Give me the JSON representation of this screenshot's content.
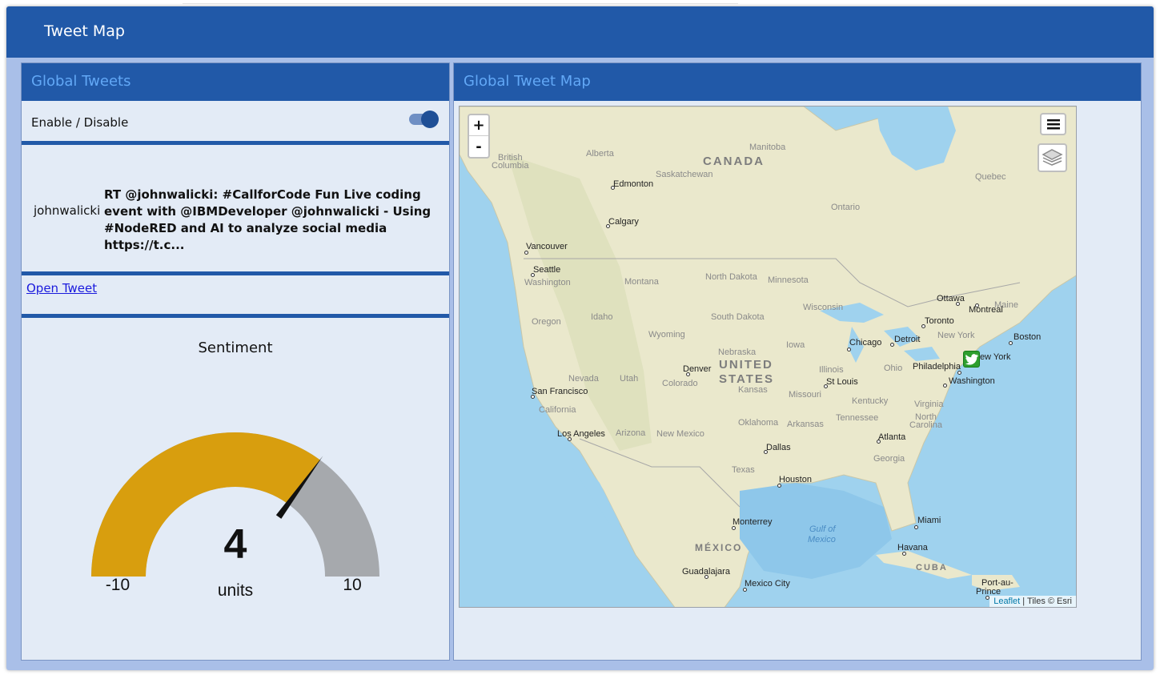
{
  "app": {
    "title": "Tweet Map"
  },
  "left_group": {
    "title": "Global Tweets",
    "toggle_label": "Enable / Disable",
    "toggle_on": true,
    "tweet_user": "johnwalicki",
    "tweet_text": "RT @johnwalicki: #CallforCode Fun Live coding event with @IBMDeveloper @johnwalicki - Using #NodeRED and AI to analyze social media https://t.c...",
    "open_link": "Open Tweet"
  },
  "gauge": {
    "title": "Sentiment",
    "value": 4,
    "value_text": "4",
    "min": -10,
    "max": 10,
    "min_text": "-10",
    "max_text": "10",
    "units": "units",
    "fill_color": "#d89e0e",
    "track_color": "#a6a9ad"
  },
  "map_group": {
    "title": "Global Tweet Map",
    "zoom_in": "+",
    "zoom_out": "-",
    "attribution_leaflet": "Leaflet",
    "attribution_tiles": "| Tiles © Esri",
    "labels": {
      "canada": "CANADA",
      "usa1": "UNITED",
      "usa2": "STATES",
      "mexico": "MÉXICO",
      "cuba": "CUBA",
      "british_columbia1": "British",
      "british_columbia2": "Columbia",
      "alberta": "Alberta",
      "saskatchewan": "Saskatchewan",
      "manitoba": "Manitoba",
      "ontario": "Ontario",
      "quebec": "Quebec",
      "washington_state": "Washington",
      "montana": "Montana",
      "north_dakota": "North Dakota",
      "minnesota": "Minnesota",
      "wisconsin": "Wisconsin",
      "oregon": "Oregon",
      "idaho": "Idaho",
      "south_dakota": "South Dakota",
      "wyoming": "Wyoming",
      "iowa": "Iowa",
      "nebraska": "Nebraska",
      "nevada": "Nevada",
      "utah": "Utah",
      "colorado": "Colorado",
      "kansas": "Kansas",
      "illinois": "Illinois",
      "ohio": "Ohio",
      "missouri": "Missouri",
      "kentucky": "Kentucky",
      "virginia": "Virginia",
      "california": "California",
      "arizona": "Arizona",
      "new_mexico": "New Mexico",
      "oklahoma": "Oklahoma",
      "arkansas": "Arkansas",
      "tennessee": "Tennessee",
      "north_carolina1": "North",
      "north_carolina2": "Carolina",
      "georgia": "Georgia",
      "texas": "Texas",
      "maine": "Maine",
      "new_york_state": "New York",
      "edmonton": "Edmonton",
      "calgary": "Calgary",
      "vancouver": "Vancouver",
      "seattle": "Seattle",
      "ottawa": "Ottawa",
      "montreal": "Montreal",
      "toronto": "Toronto",
      "boston": "Boston",
      "detroit": "Detroit",
      "chicago": "Chicago",
      "new_york": "New York",
      "philadelphia": "Philadelphia",
      "washington_dc": "Washington",
      "denver": "Denver",
      "st_louis": "St Louis",
      "san_francisco": "San Francisco",
      "los_angeles": "Los Angeles",
      "atlanta": "Atlanta",
      "dallas": "Dallas",
      "houston": "Houston",
      "monterrey": "Monterrey",
      "miami": "Miami",
      "havana": "Havana",
      "guadalajara": "Guadalajara",
      "mexico_city": "Mexico City",
      "port_au_prince1": "Port-au-",
      "port_au_prince2": "Prince",
      "gulf_of_mexico1": "Gulf of",
      "gulf_of_mexico2": "Mexico"
    }
  },
  "colors": {
    "header_bg": "#2159a8",
    "group_title": "#62a8f6",
    "panel_bg": "#e3ebf6",
    "page_bg": "#a9bfe8",
    "marker_green": "#2e9e2e"
  },
  "icons": {
    "menu": "hamburger-menu-icon",
    "layers": "layers-icon",
    "marker": "twitter-bird-icon"
  }
}
